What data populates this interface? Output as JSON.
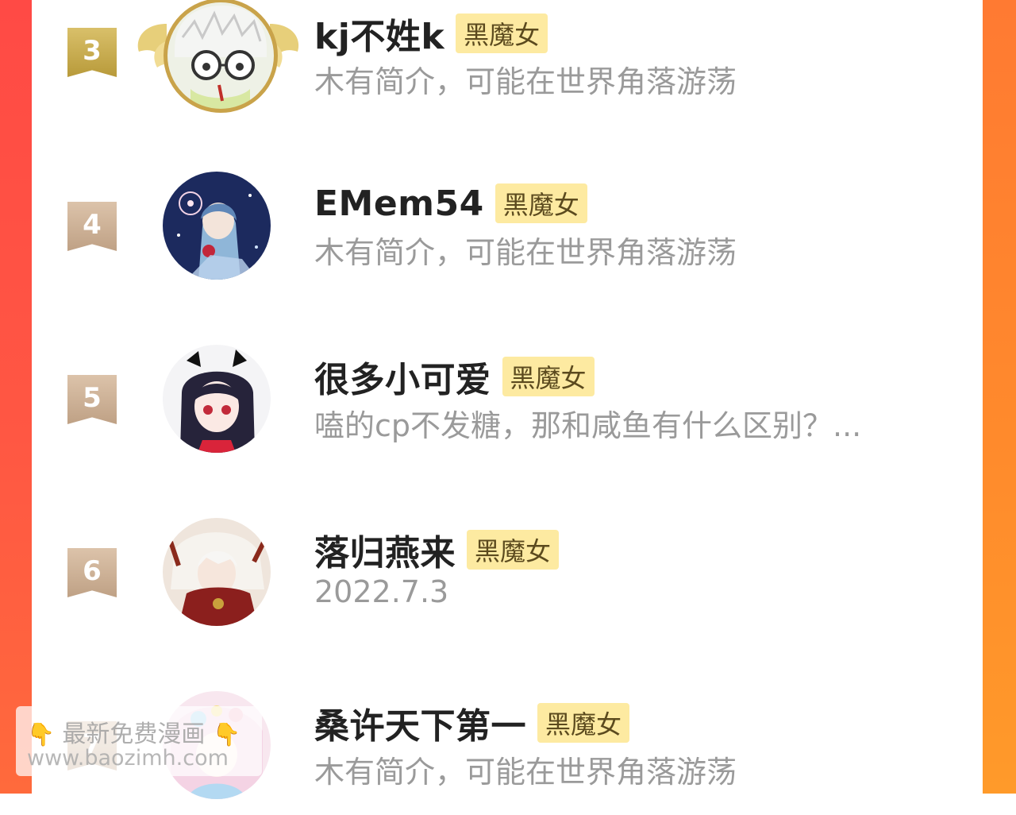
{
  "colors": {
    "left_border": "#ff4a45",
    "right_border": "#ff8a2c",
    "badge_bg": "#fdeaa1",
    "badge_text": "#5b4a1e",
    "name_text": "#222222",
    "bio_text": "#9a9a9a",
    "rank_gold": "#c9aa4a",
    "rank_tan": "#cdb096"
  },
  "rows": [
    {
      "rank": "3",
      "name": "kj不姓k",
      "badge": "黑魔女",
      "bio": "木有简介，可能在世界角落游荡",
      "avatar_icon": "white-haired-glasses-avatar-icon"
    },
    {
      "rank": "4",
      "name": "EMem54",
      "badge": "黑魔女",
      "bio": "木有简介，可能在世界角落游荡",
      "avatar_icon": "starry-night-girl-avatar-icon"
    },
    {
      "rank": "5",
      "name": "很多小可爱",
      "badge": "黑魔女",
      "bio": "嗑的cp不发糖，那和咸鱼有什么区别？...",
      "avatar_icon": "horned-dark-haired-girl-avatar-icon"
    },
    {
      "rank": "6",
      "name": "落归燕来",
      "badge": "黑魔女",
      "bio": "2022.7.3",
      "avatar_icon": "white-haired-red-robe-avatar-icon"
    },
    {
      "rank": "7",
      "name": "桑许天下第一",
      "badge": "黑魔女",
      "bio": "木有简介，可能在世界角落游荡",
      "avatar_icon": "pastel-colorful-avatar-icon"
    }
  ],
  "watermark": {
    "line1": "最新免费漫画",
    "line2": "www.baozimh.com",
    "icon": "pointing-down-hand-icon"
  }
}
